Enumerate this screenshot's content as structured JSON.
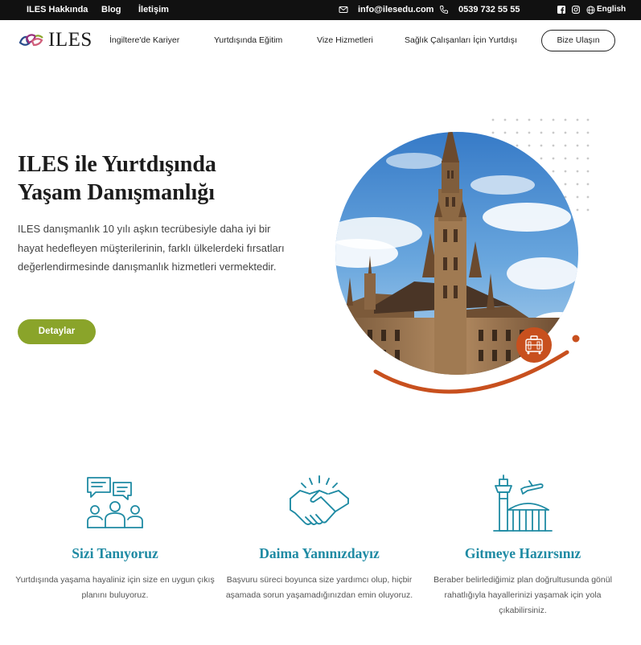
{
  "topbar": {
    "links": [
      "ILES Hakkında",
      "Blog",
      "İletişim"
    ],
    "email": "info@ilesedu.com",
    "phone": "0539 732 55 55",
    "language": "English",
    "icons": [
      "mail-icon",
      "phone-icon",
      "facebook-icon",
      "instagram-icon",
      "globe-icon"
    ]
  },
  "nav": {
    "logo_text": "ILES",
    "links": [
      "İngiltere'de Kariyer",
      "Yurtdışında Eğitim",
      "Vize Hizmetleri",
      "Sağlık Çalışanları İçin Yurtdışı"
    ],
    "cta": "Bize Ulaşın"
  },
  "hero": {
    "title_line1": "ILES ile Yurtdışında",
    "title_line2": "Yaşam Danışmanlığı",
    "description": "ILES danışmanlık 10 yılı aşkın tecrübesiyle daha iyi bir hayat hedefleyen müşterilerinin, farklı ülkelerdeki fırsatları değerlendirmesinde danışmanlık hizmetleri vermektedir.",
    "button": "Detaylar",
    "image": "gothic-town-hall-tower-under-blue-sky",
    "badge_icon": "luggage-icon"
  },
  "features": [
    {
      "icon": "people-chat-icon",
      "title": "Sizi Tanıyoruz",
      "text": "Yurtdışında yaşama hayaliniz için size en uygun çıkış planını buluyoruz."
    },
    {
      "icon": "handshake-icon",
      "title": "Daima Yanınızdayız",
      "text": "Başvuru süreci boyunca size yardımcı olup, hiçbir aşamada sorun yaşamadığınızdan emin oluyoruz."
    },
    {
      "icon": "airport-tower-icon",
      "title": "Gitmeye Hazırsınız",
      "text": "Beraber belirlediğimiz plan doğrultusunda gönül rahatlığıyla hayallerinizi yaşamak için yola çıkabilirsiniz."
    }
  ],
  "colors": {
    "accent_green": "#8aa42a",
    "accent_teal": "#1e8aa3",
    "accent_orange": "#c8501e",
    "topbar_bg": "#111111"
  }
}
